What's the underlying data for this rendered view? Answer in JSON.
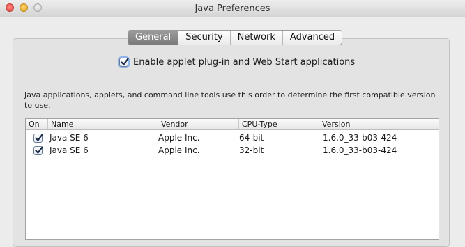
{
  "window": {
    "title": "Java Preferences"
  },
  "tabs": [
    {
      "label": "General",
      "selected": true
    },
    {
      "label": "Security",
      "selected": false
    },
    {
      "label": "Network",
      "selected": false
    },
    {
      "label": "Advanced",
      "selected": false
    }
  ],
  "general": {
    "enable_label": "Enable applet plug-in and Web Start applications",
    "enable_checked": true,
    "description": "Java applications, applets, and command line tools use this order to determine the first compatible version to use."
  },
  "table": {
    "columns": [
      "On",
      "Name",
      "Vendor",
      "CPU-Type",
      "Version"
    ],
    "rows": [
      {
        "on": true,
        "name": "Java SE 6",
        "vendor": "Apple Inc.",
        "cpu": "64-bit",
        "version": "1.6.0_33-b03-424"
      },
      {
        "on": true,
        "name": "Java SE 6",
        "vendor": "Apple Inc.",
        "cpu": "32-bit",
        "version": "1.6.0_33-b03-424"
      }
    ]
  },
  "colors": {
    "selected_tab": "#8a8a8a",
    "focus_ring": "#8fb4e8",
    "checkmark": "#1d2a44"
  }
}
